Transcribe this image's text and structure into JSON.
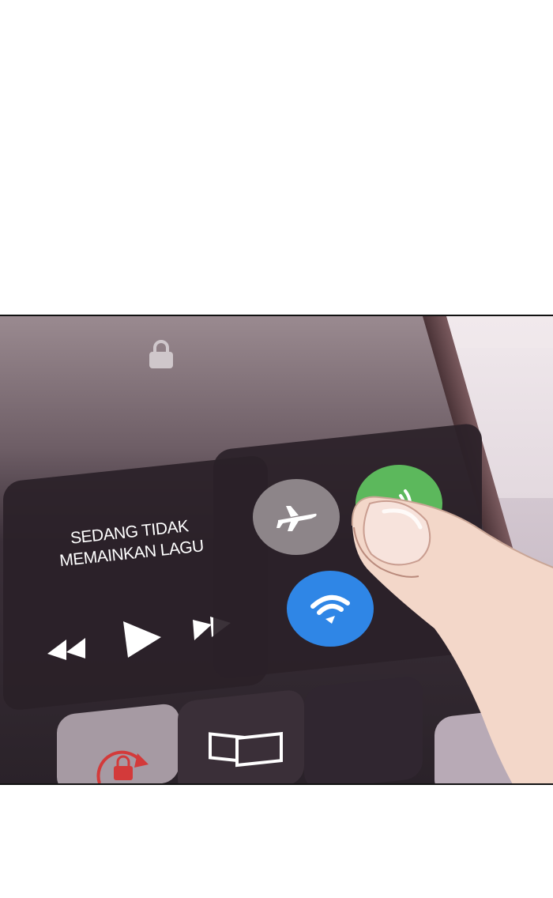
{
  "media_widget": {
    "status_line_1": "SEDANG TIDAK",
    "status_line_2": "MEMAINKAN LAGU"
  },
  "icons": {
    "lock": "lock-icon",
    "rewind": "rewind-icon",
    "play": "play-icon",
    "fast_forward": "fast-forward-icon",
    "airplane": "airplane-icon",
    "mobile_data": "mobile-data-icon",
    "wifi": "wifi-icon",
    "rotation_lock": "rotation-lock-icon",
    "screen_mirror": "screen-mirror-icon"
  },
  "colors": {
    "airplane_off": "#8d8589",
    "mobile_data_on": "#5cb85c",
    "wifi_on": "#2f86e6",
    "rotation_lock_red": "#d33a3a"
  },
  "toggles": {
    "airplane_mode": false,
    "mobile_data": true,
    "wifi": true
  }
}
